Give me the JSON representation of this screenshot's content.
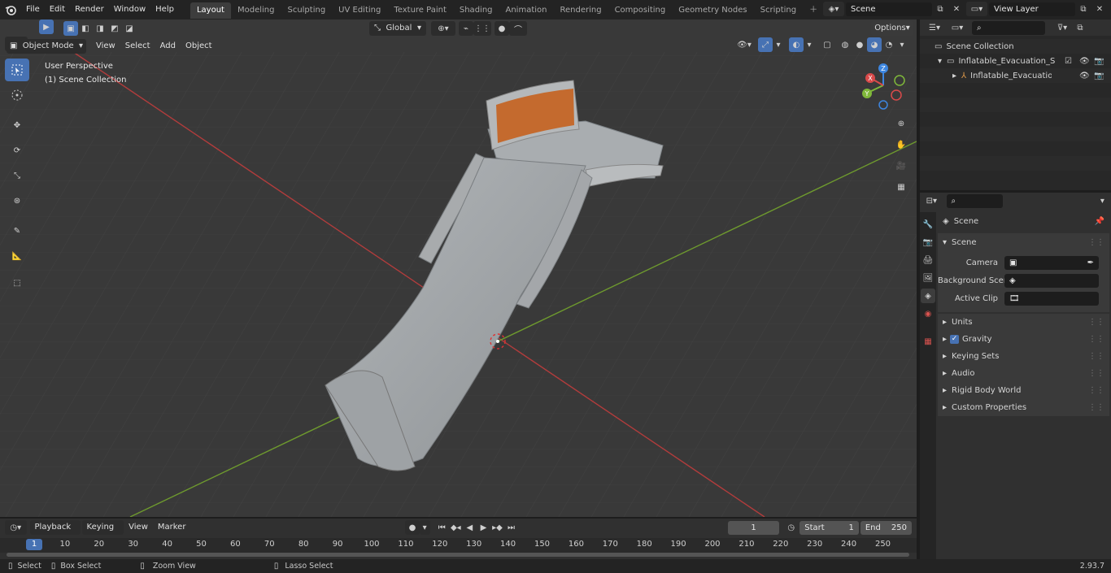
{
  "topbar": {
    "menus": [
      "File",
      "Edit",
      "Render",
      "Window",
      "Help"
    ],
    "workspaces": [
      "Layout",
      "Modeling",
      "Sculpting",
      "UV Editing",
      "Texture Paint",
      "Shading",
      "Animation",
      "Rendering",
      "Compositing",
      "Geometry Nodes",
      "Scripting"
    ],
    "active_workspace": "Layout",
    "scene_name": "Scene",
    "view_layer": "View Layer"
  },
  "viewport": {
    "orientation": "Global",
    "options_label": "Options",
    "mode": "Object Mode",
    "menus": [
      "View",
      "Select",
      "Add",
      "Object"
    ],
    "overlay_title": "User Perspective",
    "overlay_subtitle": "(1) Scene Collection",
    "gizmo": {
      "x": "X",
      "y": "Y",
      "z": "Z"
    }
  },
  "outliner": {
    "root": "Scene Collection",
    "items": [
      {
        "label": "Inflatable_Evacuation_Slide_V"
      },
      {
        "label": "Inflatable_Evacuation_Sli"
      }
    ]
  },
  "properties": {
    "header_title": "Scene",
    "section_title": "Scene",
    "fields": [
      {
        "label": "Camera"
      },
      {
        "label": "Background Scene"
      },
      {
        "label": "Active Clip"
      }
    ],
    "panels": [
      "Units",
      "Gravity",
      "Keying Sets",
      "Audio",
      "Rigid Body World",
      "Custom Properties"
    ],
    "gravity_checked": true
  },
  "timeline": {
    "menus": [
      "Playback",
      "Keying",
      "View",
      "Marker"
    ],
    "current_frame": "1",
    "start_label": "Start",
    "start": "1",
    "end_label": "End",
    "end": "250",
    "ruler": [
      "1",
      "10",
      "20",
      "30",
      "40",
      "50",
      "60",
      "70",
      "80",
      "90",
      "100",
      "110",
      "120",
      "130",
      "140",
      "150",
      "160",
      "170",
      "180",
      "190",
      "200",
      "210",
      "220",
      "230",
      "240",
      "250"
    ]
  },
  "statusbar": {
    "select": "Select",
    "box_select": "Box Select",
    "zoom_view": "Zoom View",
    "lasso_select": "Lasso Select",
    "version": "2.93.7"
  },
  "colors": {
    "accent": "#4772b3",
    "x_axis": "#d94a4a",
    "y_axis": "#7fb83a",
    "z_axis": "#3d86e0",
    "orange_texture": "#c46a2e"
  }
}
